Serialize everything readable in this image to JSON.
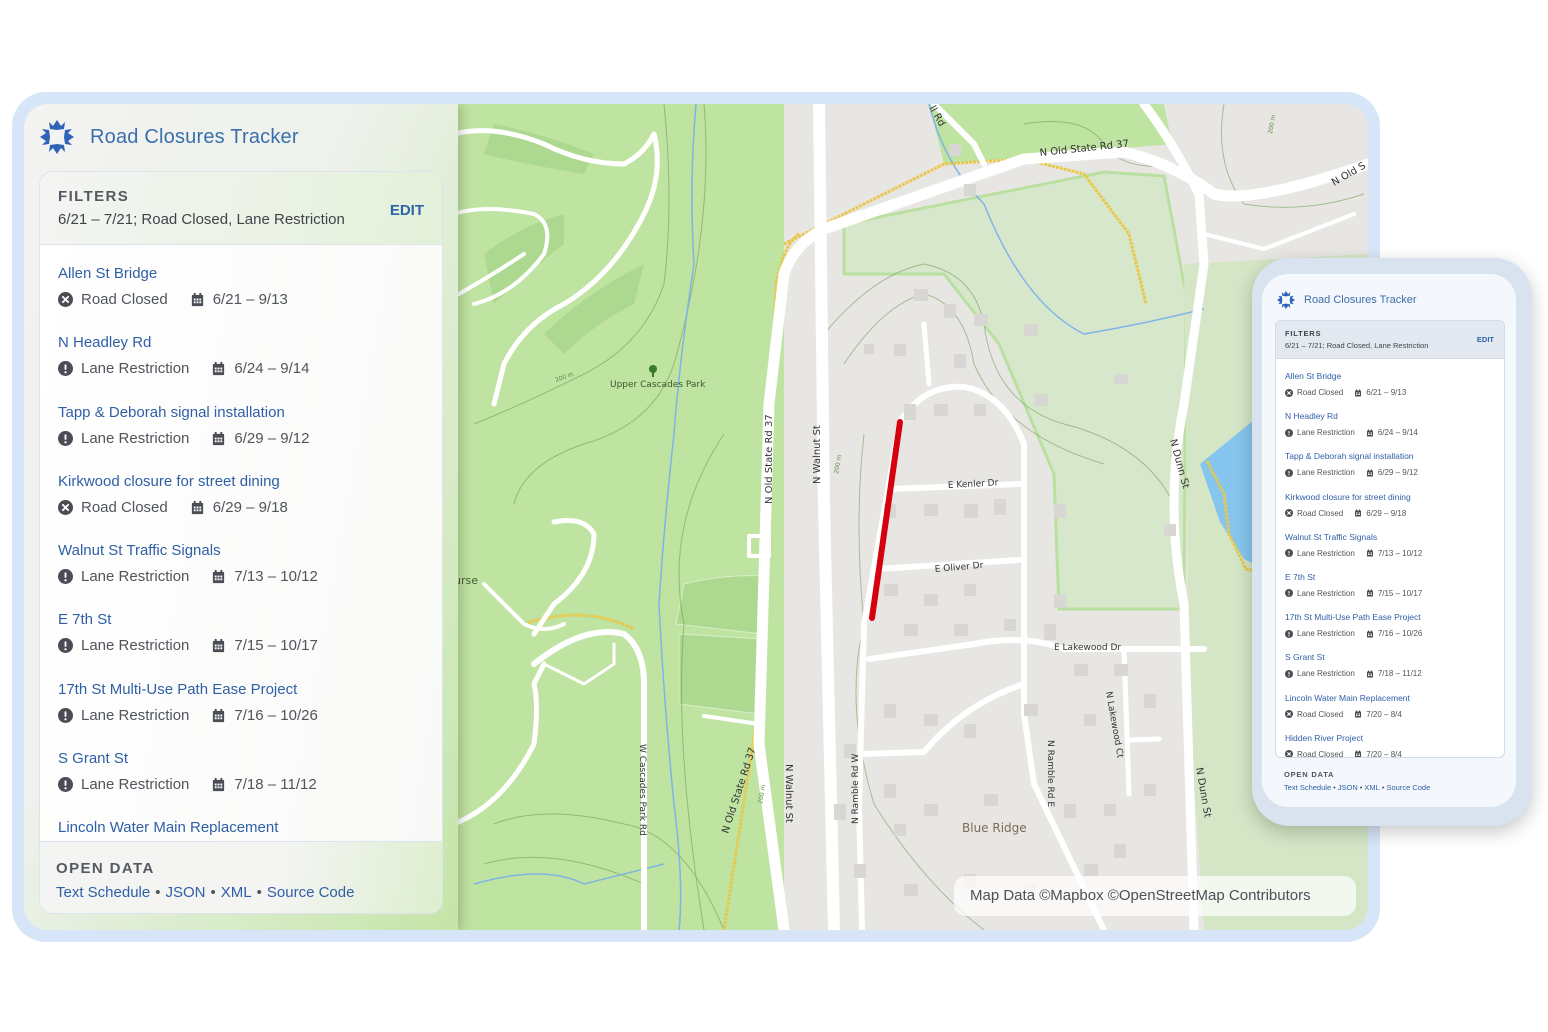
{
  "app": {
    "title": "Road Closures Tracker",
    "logo_icon": "snowflake-star-logo",
    "accent_color": "#2f5fa7",
    "closure_line_color": "#d7000f"
  },
  "filters": {
    "label": "FILTERS",
    "summary": "6/21 – 7/21; Road Closed, Lane Restriction",
    "edit_label": "EDIT"
  },
  "closures": [
    {
      "name": "Allen St Bridge",
      "type": "Road Closed",
      "type_icon": "x-circle-icon",
      "dates": "6/21 – 9/13"
    },
    {
      "name": "N Headley Rd",
      "type": "Lane Restriction",
      "type_icon": "exclamation-circle-icon",
      "dates": "6/24 – 9/14"
    },
    {
      "name": "Tapp & Deborah signal installation",
      "type": "Lane Restriction",
      "type_icon": "exclamation-circle-icon",
      "dates": "6/29 – 9/12"
    },
    {
      "name": "Kirkwood closure for street dining",
      "type": "Road Closed",
      "type_icon": "x-circle-icon",
      "dates": "6/29 – 9/18"
    },
    {
      "name": "Walnut St Traffic Signals",
      "type": "Lane Restriction",
      "type_icon": "exclamation-circle-icon",
      "dates": "7/13 – 10/12"
    },
    {
      "name": "E 7th St",
      "type": "Lane Restriction",
      "type_icon": "exclamation-circle-icon",
      "dates": "7/15 – 10/17"
    },
    {
      "name": "17th St Multi-Use Path Ease Project",
      "type": "Lane Restriction",
      "type_icon": "exclamation-circle-icon",
      "dates": "7/16 – 10/26"
    },
    {
      "name": "S Grant St",
      "type": "Lane Restriction",
      "type_icon": "exclamation-circle-icon",
      "dates": "7/18 – 11/12"
    },
    {
      "name": "Lincoln Water Main Replacement",
      "type": "Road Closed",
      "type_icon": "x-circle-icon",
      "dates": "7/20 – 8/4"
    },
    {
      "name": "Hidden River Project",
      "type": "Road Closed",
      "type_icon": "x-circle-icon",
      "dates": "7/20 – 8/4"
    }
  ],
  "open_data": {
    "label": "OPEN DATA",
    "links": [
      "Text Schedule",
      "JSON",
      "XML",
      "Source Code"
    ],
    "separator": "•"
  },
  "map": {
    "attribution": "Map Data ©Mapbox ©OpenStreetMap Contributors",
    "labels": {
      "n_old_state_rd_37_top": "N Old State Rd 37",
      "n_old_state_rd_37_mid": "N Old State Rd 37",
      "n_old_state_rd_37_low": "N Old State Rd 37",
      "n_old_right": "N Old S",
      "n_walnut_st_top": "N Walnut St",
      "n_walnut_st_low": "N Walnut St",
      "rd_fragment": "ll Rd",
      "upper_cascades_park": "Upper Cascades Park",
      "course_fragment": "urse",
      "w_cascades_park_rd": "W Cascades Park Rd",
      "e_kenler_dr": "E Kenler Dr",
      "e_oliver_dr": "E Oliver Dr",
      "e_lakewood_dr": "E Lakewood Dr",
      "n_lakewood_ct": "N Lakewood Ct",
      "n_ramble_rd_w": "N Ramble Rd W",
      "n_ramble_rd_e": "N Ramble Rd E",
      "n_dunn_st_top": "N Dunn St",
      "n_dunn_st_low": "N Dunn St",
      "blue_ridge": "Blue Ridge",
      "contour_200m": "200 m"
    }
  },
  "mobile": {
    "title": "Road Closures Tracker",
    "filters_label": "FILTERS",
    "filters_summary": "6/21 – 7/21; Road Closed, Lane Restriction",
    "edit_label": "EDIT",
    "open_data_label": "OPEN DATA"
  }
}
